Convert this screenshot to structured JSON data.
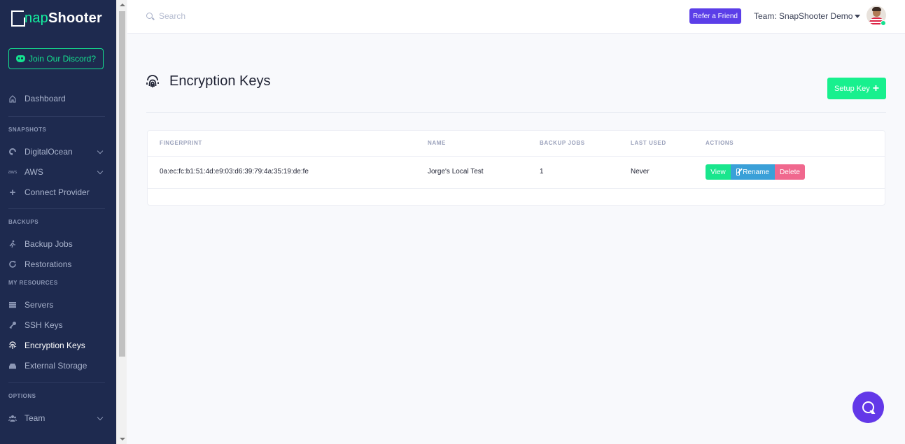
{
  "sidebar": {
    "logo": {
      "first": "S",
      "middle": "nap",
      "last": "Shooter"
    },
    "discord_label": "Join Our Discord?",
    "dashboard": "Dashboard",
    "sections": {
      "snapshots": "SNAPSHOTS",
      "backups": "BACKUPS",
      "resources": "MY RESOURCES",
      "options": "OPTIONS"
    },
    "items": {
      "digitalocean": "DigitalOcean",
      "aws": "AWS",
      "connect_provider": "Connect Provider",
      "backup_jobs": "Backup Jobs",
      "restorations": "Restorations",
      "servers": "Servers",
      "ssh_keys": "SSH Keys",
      "encryption_keys": "Encryption Keys",
      "external_storage": "External Storage",
      "team": "Team"
    },
    "active_item": "encryption_keys"
  },
  "topbar": {
    "search_placeholder": "Search",
    "refer_label": "Refer a Friend",
    "team_label": "Team: SnapShooter Demo"
  },
  "page": {
    "title": "Encryption Keys",
    "setup_label": "Setup Key"
  },
  "table": {
    "headers": [
      "FINGERPRINT",
      "NAME",
      "BACKUP JOBS",
      "LAST USED",
      "ACTIONS"
    ],
    "rows": [
      {
        "fingerprint": "0a:ec:fc:b1:51:4d:e9:03:d6:39:79:4a:35:19:de:fe",
        "name": "Jorge's Local Test",
        "backup_jobs": "1",
        "last_used": "Never",
        "actions": {
          "view": "View",
          "rename": "Rename",
          "delete": "Delete"
        }
      }
    ]
  },
  "colors": {
    "sidebar_bg": "#1e2a4f",
    "accent_green": "#18f08e",
    "purple": "#5b3ee8",
    "rename_blue": "#3aa0d8",
    "delete_pink": "#f0688e"
  }
}
